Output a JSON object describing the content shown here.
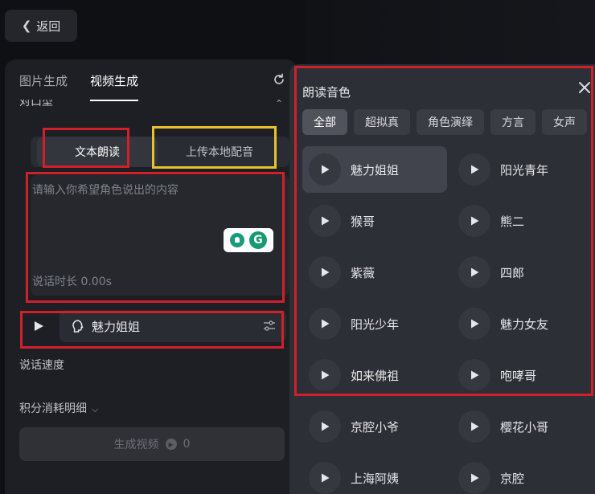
{
  "back": {
    "label": "返回"
  },
  "left_panel": {
    "tabs": [
      {
        "label": "图片生成"
      },
      {
        "label": "视频生成"
      }
    ],
    "section_title": "对口型",
    "mode_switch": {
      "tts": "文本朗读",
      "upload": "上传本地配音"
    },
    "text_input": {
      "placeholder": "请输入你希望角色说出的内容",
      "duration": "说话时长 0.00s"
    },
    "voice_select": {
      "value": "魅力姐姐"
    },
    "speed_label": "说话速度",
    "points_label": "积分消耗明细",
    "generate": {
      "label": "生成视频",
      "cost": "0"
    }
  },
  "right_panel": {
    "title": "朗读音色",
    "categories": [
      "全部",
      "超拟真",
      "角色演绎",
      "方言",
      "女声"
    ],
    "voices": [
      "魅力姐姐",
      "阳光青年",
      "猴哥",
      "熊二",
      "紫薇",
      "四郎",
      "阳光少年",
      "魅力女友",
      "如来佛祖",
      "咆哮哥",
      "京腔小爷",
      "樱花小哥",
      "上海阿姨",
      "京腔"
    ],
    "selected_voice": "魅力姐姐"
  },
  "colors": {
    "annotation_red": "#d0202a",
    "annotation_yellow": "#e8c22a",
    "panel_bg": "#2d2f36"
  }
}
